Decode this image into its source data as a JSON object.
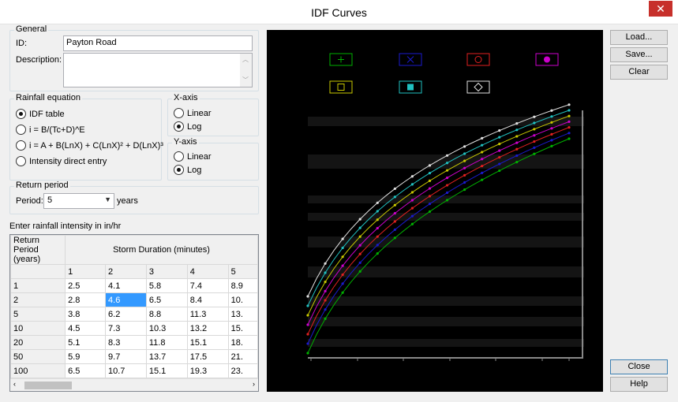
{
  "window": {
    "title": "IDF Curves",
    "close_glyph": "✕"
  },
  "general": {
    "group_label": "General",
    "id_label": "ID:",
    "id_value": "Payton Road",
    "description_label": "Description:",
    "description_value": ""
  },
  "rainfall_equation": {
    "group_label": "Rainfall equation",
    "options": [
      {
        "label": "IDF table",
        "selected": true
      },
      {
        "label": "i = B/(Tc+D)^E",
        "selected": false
      },
      {
        "label": "i = A + B(LnX) + C(LnX)² + D(LnX)³",
        "selected": false
      },
      {
        "label": "Intensity direct entry",
        "selected": false
      }
    ]
  },
  "x_axis": {
    "group_label": "X-axis",
    "options": [
      {
        "label": "Linear",
        "selected": false
      },
      {
        "label": "Log",
        "selected": true
      }
    ]
  },
  "y_axis": {
    "group_label": "Y-axis",
    "options": [
      {
        "label": "Linear",
        "selected": false
      },
      {
        "label": "Log",
        "selected": true
      }
    ]
  },
  "return_period": {
    "group_label": "Return period",
    "period_label": "Period:",
    "period_value": "5",
    "units": "years"
  },
  "intensity_table": {
    "caption": "Enter rainfall intensity in in/hr",
    "corner_header": "Return Period (years)",
    "duration_header": "Storm Duration (minutes)",
    "durations": [
      "1",
      "2",
      "3",
      "4",
      "5"
    ],
    "rows": [
      {
        "period": "1",
        "values": [
          "2.5",
          "4.1",
          "5.8",
          "7.4",
          "8.9"
        ]
      },
      {
        "period": "2",
        "values": [
          "2.8",
          "4.6",
          "6.5",
          "8.4",
          "10."
        ]
      },
      {
        "period": "5",
        "values": [
          "3.8",
          "6.2",
          "8.8",
          "11.3",
          "13."
        ]
      },
      {
        "period": "10",
        "values": [
          "4.5",
          "7.3",
          "10.3",
          "13.2",
          "15."
        ]
      },
      {
        "period": "20",
        "values": [
          "5.1",
          "8.3",
          "11.8",
          "15.1",
          "18."
        ]
      },
      {
        "period": "50",
        "values": [
          "5.9",
          "9.7",
          "13.7",
          "17.5",
          "21."
        ]
      },
      {
        "period": "100",
        "values": [
          "6.5",
          "10.7",
          "15.1",
          "19.3",
          "23."
        ]
      }
    ],
    "selected_cell": {
      "row": 1,
      "col": 1
    }
  },
  "buttons": {
    "load": "Load...",
    "save": "Save...",
    "clear": "Clear",
    "close": "Close",
    "help": "Help"
  },
  "chart_data": {
    "type": "line",
    "title": "",
    "xlabel": "",
    "ylabel": "",
    "x_scale": "log",
    "y_scale": "log",
    "legend_placement": "top",
    "series": [
      {
        "color": "#00b000",
        "marker": "plus",
        "values": []
      },
      {
        "color": "#1a1acc",
        "marker": "x",
        "values": []
      },
      {
        "color": "#e02020",
        "marker": "circle",
        "values": []
      },
      {
        "color": "#cc00cc",
        "marker": "filled-circle",
        "values": []
      },
      {
        "color": "#c8c800",
        "marker": "square",
        "values": []
      },
      {
        "color": "#20c0c0",
        "marker": "filled-square",
        "values": []
      },
      {
        "color": "#e0e0e0",
        "marker": "diamond",
        "values": []
      }
    ]
  }
}
